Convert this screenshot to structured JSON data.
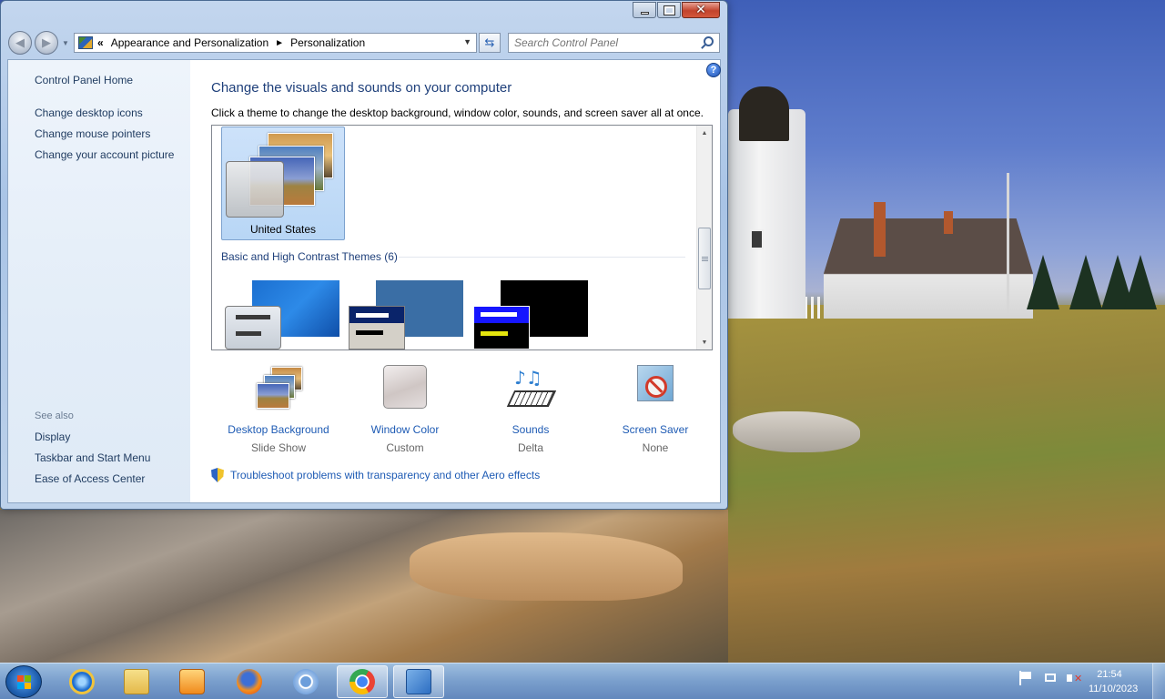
{
  "window": {
    "minimize_label": "Minimize",
    "maximize_label": "Maximize",
    "close_label": "Close"
  },
  "address_bar": {
    "overflow_chevron": "«",
    "crumbs": [
      "Appearance and Personalization",
      "Personalization"
    ],
    "separator": "►"
  },
  "search": {
    "placeholder": "Search Control Panel",
    "value": ""
  },
  "sidebar": {
    "home_link": "Control Panel Home",
    "tasks": [
      "Change desktop icons",
      "Change mouse pointers",
      "Change your account picture"
    ],
    "see_also_heading": "See also",
    "see_also": [
      "Display",
      "Taskbar and Start Menu",
      "Ease of Access Center"
    ]
  },
  "main": {
    "heading": "Change the visuals and sounds on your computer",
    "subtext": "Click a theme to change the desktop background, window color, sounds, and screen saver all at once.",
    "selected_theme": "United States",
    "basic_section_label": "Basic and High Contrast Themes (6)",
    "settings": [
      {
        "label": "Desktop Background",
        "value": "Slide Show",
        "icon": "desktop-background-icon"
      },
      {
        "label": "Window Color",
        "value": "Custom",
        "icon": "window-color-icon"
      },
      {
        "label": "Sounds",
        "value": "Delta",
        "icon": "sounds-icon"
      },
      {
        "label": "Screen Saver",
        "value": "None",
        "icon": "screen-saver-icon"
      }
    ],
    "troubleshoot_link": "Troubleshoot problems with transparency and other Aero effects"
  },
  "taskbar": {
    "apps": [
      "Internet Explorer",
      "Windows Explorer",
      "Windows Media Player",
      "Firefox",
      "Chromium",
      "Google Chrome",
      "Control Panel"
    ],
    "active_app": "Control Panel",
    "clock_time": "21:54",
    "clock_date": "11/10/2023"
  },
  "colors": {
    "link_blue": "#1e5bb4",
    "heading_blue": "#1e3f7a",
    "selection_bg": "#cde2fa"
  }
}
